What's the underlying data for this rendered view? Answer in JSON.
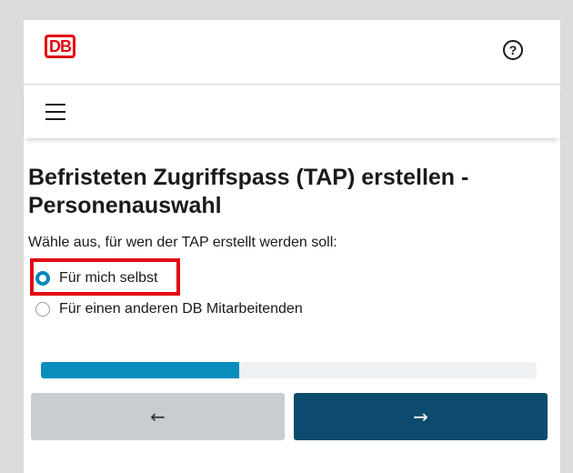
{
  "header": {
    "logo_text": "DB",
    "help_icon": "question-circle-icon",
    "help_glyph": "?"
  },
  "navbar": {
    "menu_icon": "hamburger-menu-icon"
  },
  "main": {
    "title": "Befristeten Zugriffspass (TAP) erstellen - Personenauswahl",
    "prompt": "Wähle aus, für wen der TAP erstellt werden soll:",
    "options": [
      {
        "label": "Für mich selbst",
        "selected": true
      },
      {
        "label": "Für einen anderen DB Mitarbeitenden",
        "selected": false
      }
    ]
  },
  "progress": {
    "value": 0.4
  },
  "buttons": {
    "back_glyph": "←",
    "next_glyph": "→"
  },
  "colors": {
    "brand_red": "#e30613",
    "accent_blue": "#0a8cbd",
    "primary_button": "#0d4b6e",
    "secondary_button": "#c9ccd0"
  }
}
